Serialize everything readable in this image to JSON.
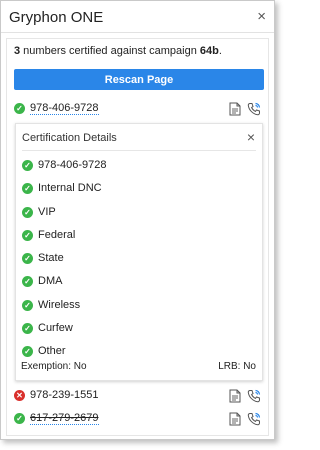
{
  "app": {
    "title": "Gryphon ONE",
    "close_glyph": "×"
  },
  "summary": {
    "count": "3",
    "text": " numbers certified against campaign ",
    "campaign": "64b",
    "suffix": "."
  },
  "rescan_label": "Rescan Page",
  "numbers": [
    {
      "number": "978-406-9728",
      "status": "ok"
    },
    {
      "number": "978-239-1551",
      "status": "bad"
    },
    {
      "number": "617-279-2679",
      "status": "ok"
    }
  ],
  "details": {
    "title": "Certification Details",
    "close_glyph": "×",
    "items": [
      "978-406-9728",
      "Internal DNC",
      "VIP",
      "Federal",
      "State",
      "DMA",
      "Wireless",
      "Curfew",
      "Other"
    ],
    "exemption": "Exemption: No",
    "lrb": "LRB: No"
  },
  "colors": {
    "accent": "#2a86e8",
    "ok": "#3bb54a",
    "bad": "#d9302c"
  },
  "icons": {
    "ok": "check-icon",
    "bad": "x-icon",
    "doc": "document-icon",
    "call": "phone-call-icon"
  }
}
